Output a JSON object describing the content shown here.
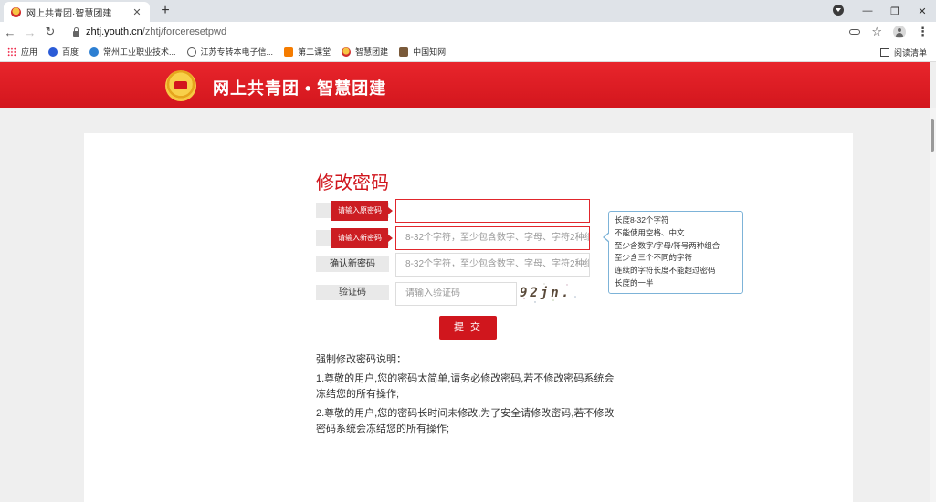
{
  "browser": {
    "tab_title": "网上共青团·智慧团建",
    "tab_close": "✕",
    "new_tab": "+",
    "url_host": "zhtj.youth.cn",
    "url_path": "/zhtj/forceresetpwd",
    "window_controls": [
      "—",
      "❐",
      "✕"
    ],
    "bookmarks": [
      {
        "label": "应用",
        "icon": "apps-icon"
      },
      {
        "label": "百度",
        "icon": "baidu-icon"
      },
      {
        "label": "常州工业职业技术...",
        "icon": "school-icon"
      },
      {
        "label": "江苏专转本电子信...",
        "icon": "globe-icon"
      },
      {
        "label": "第二课堂",
        "icon": "dk-icon"
      },
      {
        "label": "智慧团建",
        "icon": "league-icon"
      },
      {
        "label": "中国知网",
        "icon": "cnki-icon"
      }
    ],
    "reading_list": "阅读清单"
  },
  "header": {
    "title": "网上共青团 • 智慧团建"
  },
  "form": {
    "title": "修改密码",
    "rows": [
      {
        "label": "",
        "placeholder": "",
        "error": "请输入原密码"
      },
      {
        "label": "",
        "placeholder": "8-32个字符，至少包含数字、字母、字符2种组",
        "error": "请输入新密码"
      },
      {
        "label": "确认新密码",
        "placeholder": "8-32个字符，至少包含数字、字母、字符2种组"
      },
      {
        "label": "验证码",
        "placeholder": "请输入验证码"
      }
    ],
    "captcha_text": "92jn.",
    "rules": [
      "长度8-32个字符",
      "不能使用空格、中文",
      "至少含数字/字母/符号两种组合",
      "至少含三个不同的字符",
      "连续的字符长度不能超过密码",
      "长度的一半"
    ],
    "submit_label": "提 交"
  },
  "notes": {
    "title": "强制修改密码说明：",
    "items": [
      "1.尊敬的用户,您的密码太简单,请务必修改密码,若不修改密码系统会冻结您的所有操作;",
      "2.尊敬的用户,您的密码长时间未修改,为了安全请修改密码,若不修改密码系统会冻结您的所有操作;"
    ]
  },
  "colors": {
    "brand_red": "#d0161d",
    "rule_border": "#7db3d8"
  }
}
